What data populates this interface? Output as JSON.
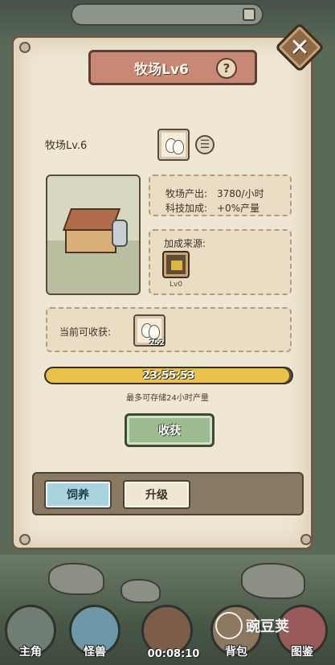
{
  "window": {
    "title": "牧场Lv6"
  },
  "facility": {
    "name_level": "牧场Lv.6"
  },
  "production": {
    "output_label": "牧场产出:",
    "output_value": "3780/小时",
    "tech_label": "科技加成:",
    "tech_value": "+0%产量"
  },
  "bonus": {
    "label": "加成来源:",
    "item_level": "Lv0"
  },
  "harvestable": {
    "label": "当前可收获:",
    "egg_count": "252"
  },
  "timer": {
    "value": "23:55:53",
    "fill_fraction": 0.99
  },
  "storage_note": "最多可存储24小时产量",
  "harvest_button": "收获",
  "tabs": [
    {
      "label": "饲养",
      "active": true
    },
    {
      "label": "升级",
      "active": false
    }
  ],
  "bottom_nav": {
    "items": [
      {
        "label": "主角",
        "icon": "helmet-icon"
      },
      {
        "label": "怪兽",
        "icon": "monster-eye-icon"
      },
      {
        "label": "背包",
        "icon": "backpack-icon"
      },
      {
        "label": "图鉴",
        "icon": "book-icon"
      }
    ],
    "timer": "00:08:10"
  },
  "watermark": "豌豆荚",
  "colors": {
    "panel": "#efe6d3",
    "ribbon": "#c88876",
    "timer_fill": "#e9c24a",
    "harvest_button": "#9dbb90",
    "active_tab": "#a9d3dd"
  }
}
